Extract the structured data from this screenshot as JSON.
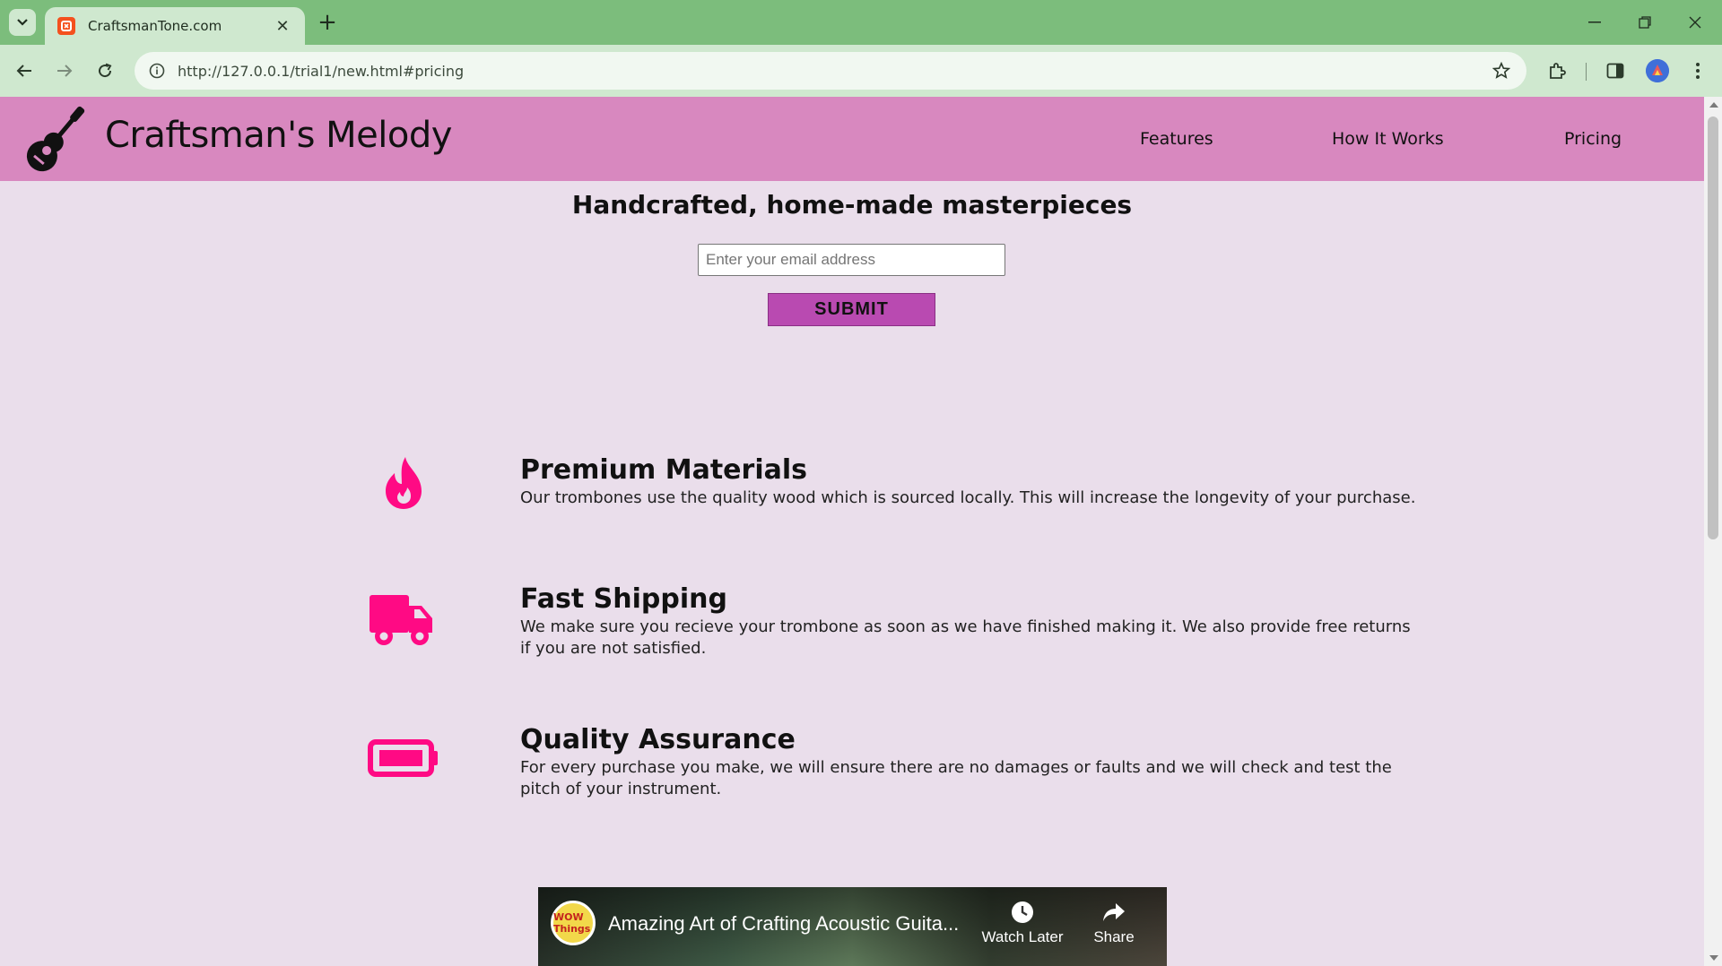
{
  "browser": {
    "tab_title": "CraftsmanTone.com",
    "url": "http://127.0.0.1/trial1/new.html#pricing"
  },
  "site": {
    "brand": "Craftsman's Melody",
    "nav": [
      {
        "label": "Features"
      },
      {
        "label": "How It Works"
      },
      {
        "label": "Pricing"
      }
    ]
  },
  "hero": {
    "title": "Handcrafted, home-made masterpieces",
    "email_placeholder": "Enter your email address",
    "submit_label": "SUBMIT"
  },
  "features": [
    {
      "icon": "fire-icon",
      "title": "Premium Materials",
      "text": "Our trombones use the quality wood which is sourced locally. This will increase the longevity of your purchase."
    },
    {
      "icon": "truck-icon",
      "title": "Fast Shipping",
      "text": "We make sure you recieve your trombone as soon as we have finished making it. We also provide free returns if you are not satisfied."
    },
    {
      "icon": "battery-icon",
      "title": "Quality Assurance",
      "text": "For every purchase you make, we will ensure there are no damages or faults and we will check and test the pitch of your instrument."
    }
  ],
  "video": {
    "channel_badge": "WOW Things",
    "title": "Amazing Art of Crafting Acoustic Guita...",
    "watch_later": "Watch Later",
    "share": "Share"
  },
  "colors": {
    "header_bg": "#d888bf",
    "page_bg": "#eadeeb",
    "accent": "#ff0a84",
    "button": "#b94ab1"
  }
}
